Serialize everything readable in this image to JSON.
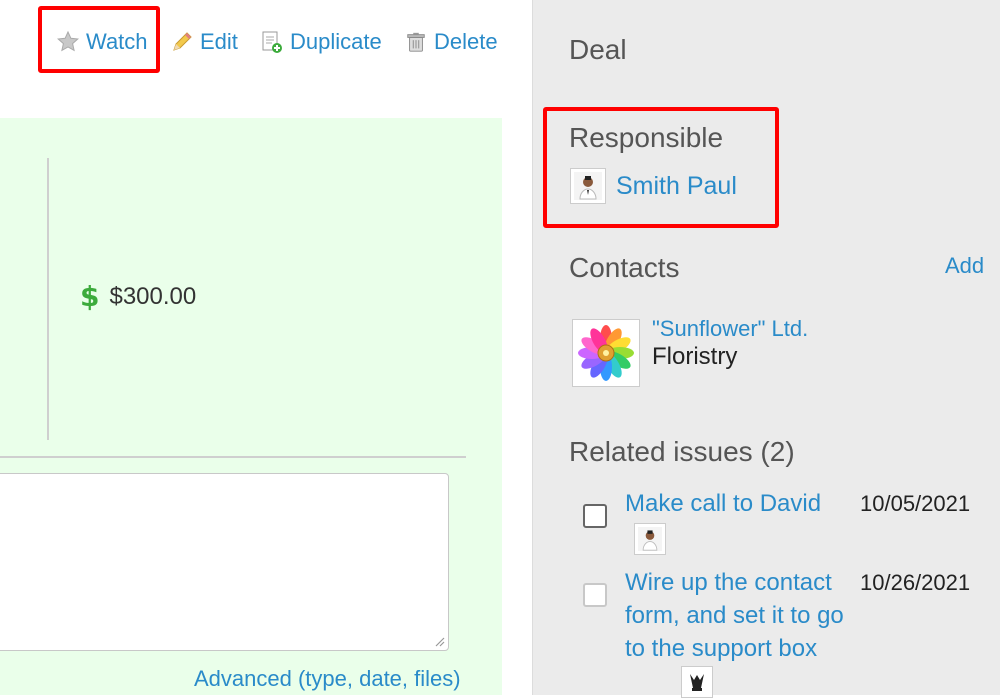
{
  "toolbar": {
    "watch_label": "Watch",
    "edit_label": "Edit",
    "duplicate_label": "Duplicate",
    "delete_label": "Delete"
  },
  "deal": {
    "amount": "$300.00",
    "advanced_link": "Advanced (type, date, files)"
  },
  "sidebar": {
    "title": "Deal",
    "responsible": {
      "heading": "Responsible",
      "name": "Smith Paul"
    },
    "contacts": {
      "heading": "Contacts",
      "add_label": "Add",
      "items": [
        {
          "name": "\"Sunflower\" Ltd.",
          "subtitle": "Floristry"
        }
      ]
    },
    "related_issues": {
      "heading": "Related issues (2)",
      "items": [
        {
          "title": "Make call to David",
          "date": "10/05/2021"
        },
        {
          "title": "Wire up the contact form, and set it to go to the support box",
          "date": "10/26/2021"
        }
      ]
    }
  },
  "colors": {
    "link": "#2a8bc9",
    "highlight": "#ff0000",
    "deal_background": "#eaffea",
    "sidebar_background": "#ebebeb",
    "dollar_icon": "#3cab3c"
  }
}
